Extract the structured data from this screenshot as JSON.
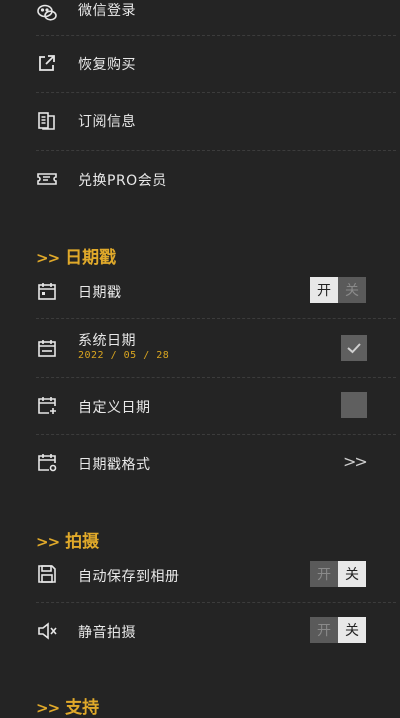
{
  "account": {
    "wechat_login": "微信登录",
    "restore_purchase": "恢复购买",
    "subscription_info": "订阅信息",
    "redeem_pro": "兑换PRO会员"
  },
  "date_stamp_section": {
    "arrows": ">>",
    "title": "日期戳",
    "items": {
      "date_stamp": {
        "label": "日期戳",
        "toggle_on": "开",
        "toggle_off": "关",
        "state": "off"
      },
      "system_date": {
        "label": "系统日期",
        "value": "2022 / 05 / 28",
        "checked": true
      },
      "custom_date": {
        "label": "自定义日期",
        "checked": false
      },
      "date_format": {
        "label": "日期戳格式",
        "chevron": ">>"
      }
    }
  },
  "shooting_section": {
    "arrows": ">>",
    "title": "拍摄",
    "items": {
      "auto_save": {
        "label": "自动保存到相册",
        "toggle_on": "开",
        "toggle_off": "关",
        "state": "off"
      },
      "silent_shoot": {
        "label": "静音拍摄",
        "toggle_on": "开",
        "toggle_off": "关",
        "state": "off"
      }
    }
  },
  "support_section": {
    "arrows": ">>",
    "title": "支持"
  },
  "colors": {
    "background": "#242424",
    "accent": "#e0a92a",
    "text": "#e8e8e8"
  }
}
